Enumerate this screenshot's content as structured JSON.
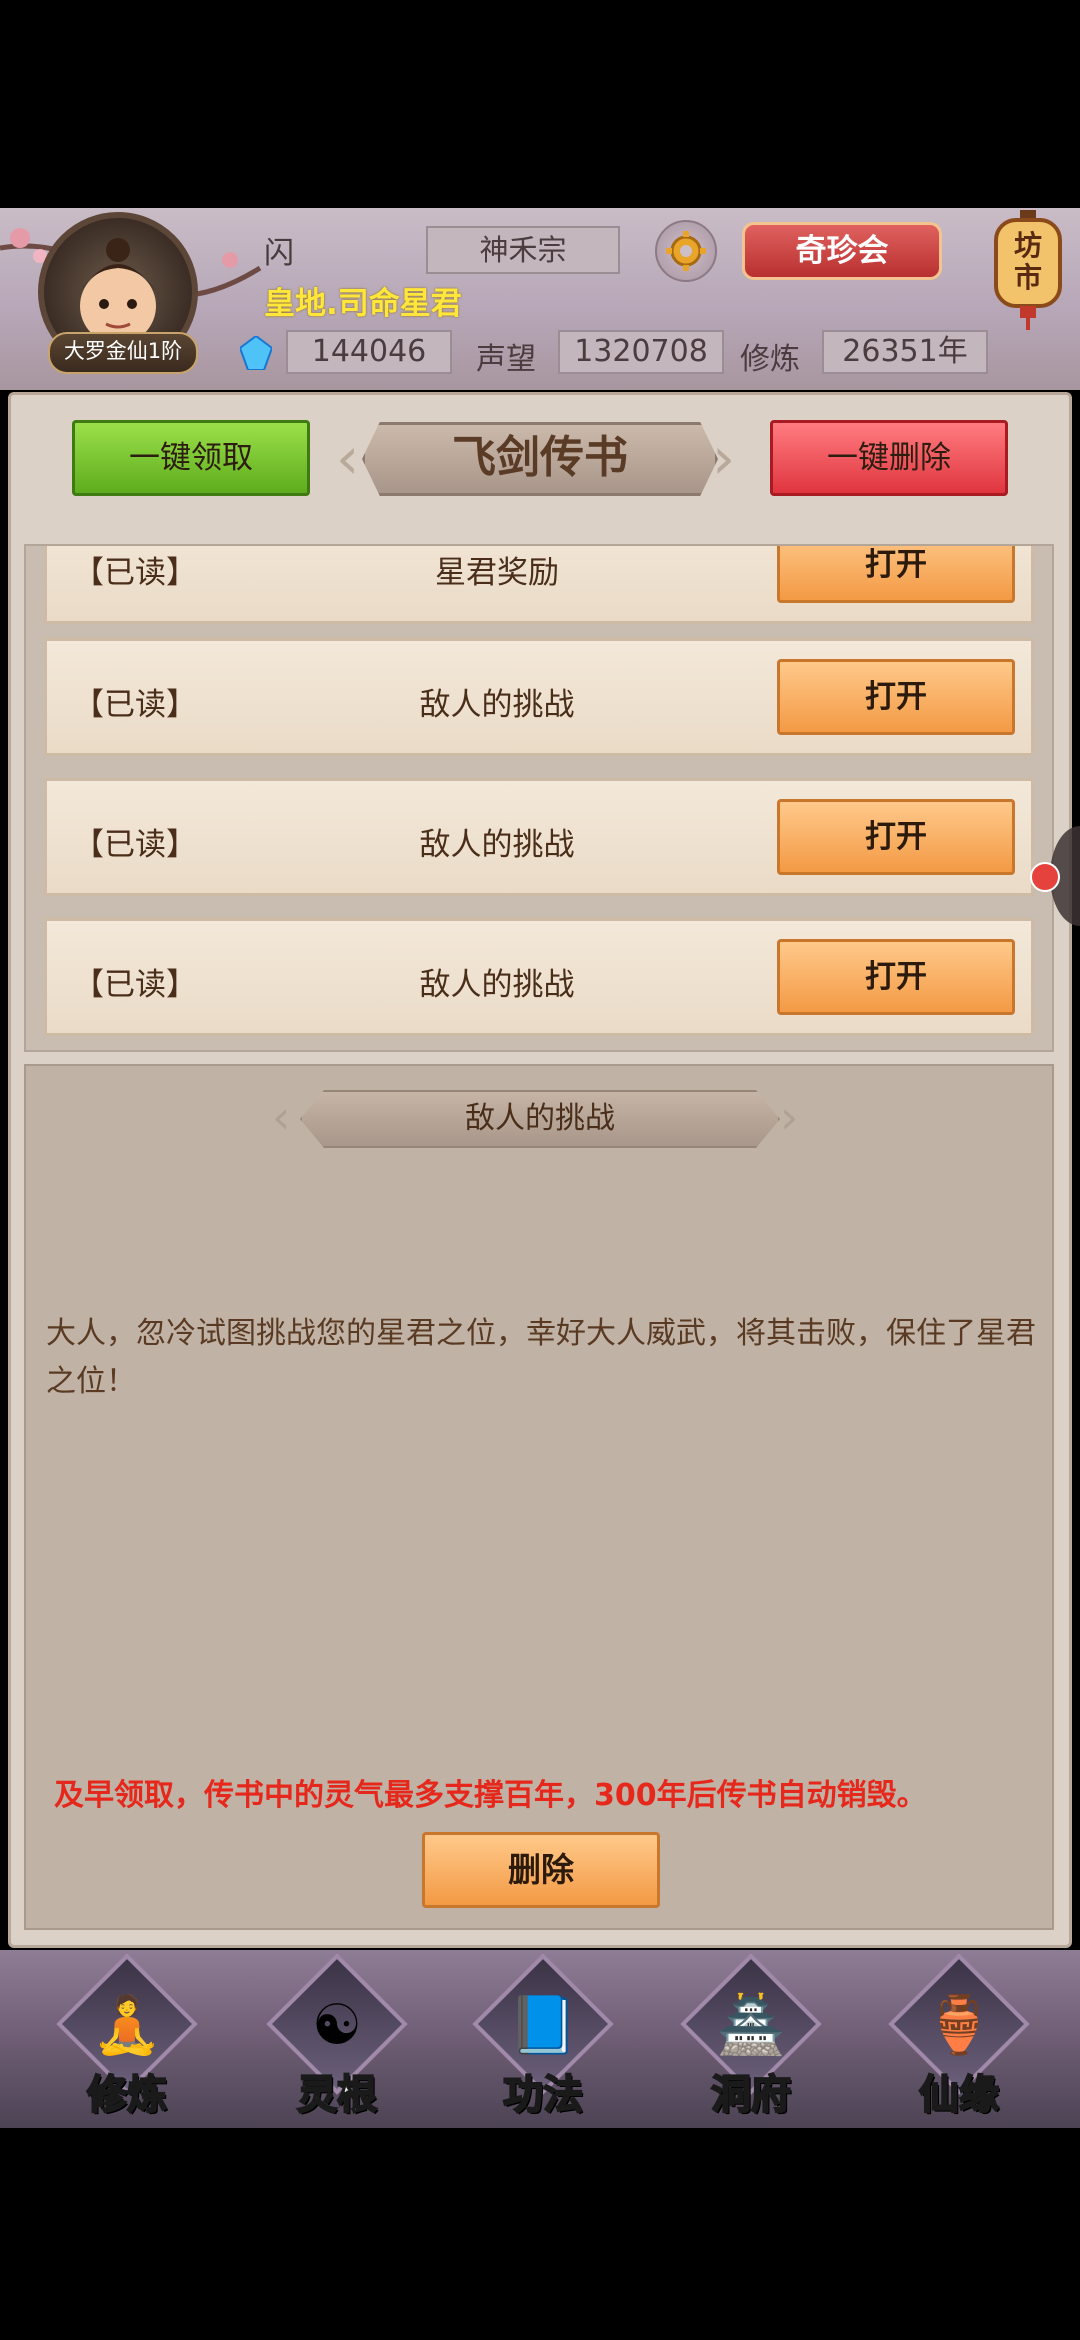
{
  "header": {
    "player_name": "闪",
    "player_title": "皇地.司命星君",
    "rank": "大罗金仙1阶",
    "sect": "神禾宗",
    "treasure_button": "奇珍会",
    "market_label": "坊市",
    "currency": "144046",
    "reputation_label": "声望",
    "reputation": "1320708",
    "cultivation_label": "修炼",
    "cultivation": "26351年"
  },
  "toolbar": {
    "claim_all": "一键领取",
    "title": "飞剑传书",
    "delete_all": "一键删除"
  },
  "mail_list": [
    {
      "status": "【已读】",
      "subject": "星君奖励",
      "action": "打开"
    },
    {
      "status": "【已读】",
      "subject": "敌人的挑战",
      "action": "打开"
    },
    {
      "status": "【已读】",
      "subject": "敌人的挑战",
      "action": "打开"
    },
    {
      "status": "【已读】",
      "subject": "敌人的挑战",
      "action": "打开"
    }
  ],
  "detail": {
    "title": "敌人的挑战",
    "message": "大人，忽冷试图挑战您的星君之位，幸好大人威武，将其击败，保住了星君之位！",
    "warning": "及早领取，传书中的灵气最多支撑百年，300年后传书自动销毁。",
    "delete_button": "删除"
  },
  "nav": [
    {
      "label": "修炼",
      "icon": "cultivate-icon",
      "active": true
    },
    {
      "label": "灵根",
      "icon": "spirit-root-icon",
      "active": false
    },
    {
      "label": "功法",
      "icon": "technique-book-icon",
      "active": false
    },
    {
      "label": "洞府",
      "icon": "cave-dwelling-icon",
      "active": false
    },
    {
      "label": "仙缘",
      "icon": "immortal-fate-icon",
      "active": false
    }
  ],
  "colors": {
    "accent_title": "#ffe63a",
    "warning": "#e6281c",
    "claim_button": "#6fbf2a",
    "delete_button": "#e0353f",
    "open_button": "#f39a45"
  }
}
